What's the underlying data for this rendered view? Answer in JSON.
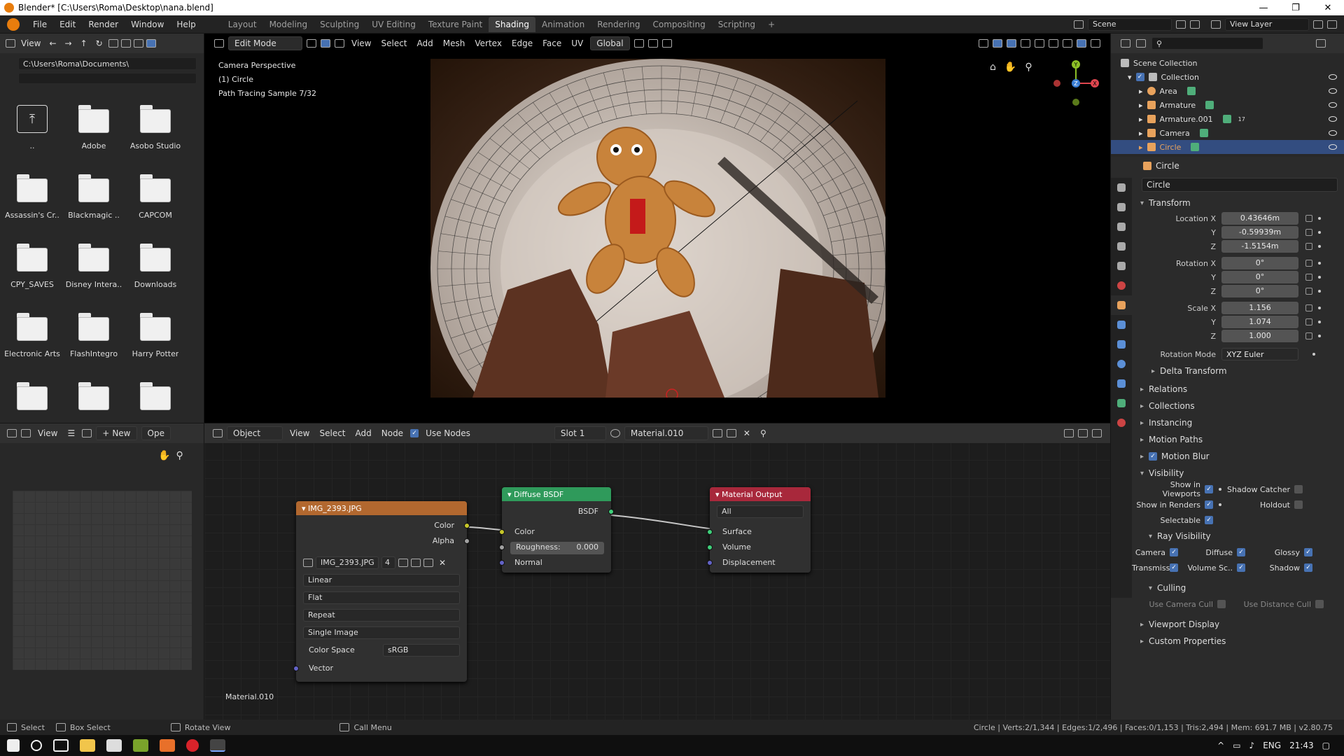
{
  "window": {
    "title": "Blender* [C:\\Users\\Roma\\Desktop\\nana.blend]",
    "min": "—",
    "max": "❐",
    "close": "✕"
  },
  "menu": {
    "items": [
      "File",
      "Edit",
      "Render",
      "Window",
      "Help"
    ]
  },
  "workspaces": {
    "tabs": [
      "Layout",
      "Modeling",
      "Sculpting",
      "UV Editing",
      "Texture Paint",
      "Shading",
      "Animation",
      "Rendering",
      "Compositing",
      "Scripting"
    ],
    "active": "Shading",
    "add": "+"
  },
  "scene": {
    "label": "Scene",
    "view_layer": "View Layer"
  },
  "filebrowser": {
    "view": "View",
    "path": "C:\\Users\\Roma\\Documents\\",
    "items": [
      {
        "label": "..",
        "type": "parent"
      },
      {
        "label": "Adobe",
        "type": "folder"
      },
      {
        "label": "Asobo Studio",
        "type": "folder"
      },
      {
        "label": "Assassin's Cr..",
        "type": "folder"
      },
      {
        "label": "Blackmagic ..",
        "type": "folder"
      },
      {
        "label": "CAPCOM",
        "type": "folder"
      },
      {
        "label": "CPY_SAVES",
        "type": "folder"
      },
      {
        "label": "Disney Intera..",
        "type": "folder"
      },
      {
        "label": "Downloads",
        "type": "folder"
      },
      {
        "label": "Electronic Arts",
        "type": "folder"
      },
      {
        "label": "FlashIntegro",
        "type": "folder"
      },
      {
        "label": "Harry Potter",
        "type": "folder"
      },
      {
        "label": "",
        "type": "folder"
      },
      {
        "label": "",
        "type": "folder"
      },
      {
        "label": "",
        "type": "folder"
      }
    ]
  },
  "viewport": {
    "mode": "Edit Mode",
    "menus": [
      "View",
      "Select",
      "Add",
      "Mesh",
      "Vertex",
      "Edge",
      "Face",
      "UV"
    ],
    "orientation": "Global",
    "info": [
      "Camera Perspective",
      "(1) Circle",
      "Path Tracing Sample 7/32"
    ],
    "gizmo": {
      "y": "Y",
      "z": "Z",
      "x": "X"
    }
  },
  "outliner": {
    "root": "Scene Collection",
    "collection": "Collection",
    "items": [
      {
        "label": "Area",
        "color": "#e8a25c"
      },
      {
        "label": "Armature",
        "color": "#e8a25c"
      },
      {
        "label": "Armature.001",
        "color": "#e8a25c"
      },
      {
        "label": "Camera",
        "color": "#e8a25c"
      },
      {
        "label": "Circle",
        "color": "#e8a25c",
        "selected": true
      }
    ],
    "armature_count": "17"
  },
  "properties": {
    "object_name": "Circle",
    "name_field": "Circle",
    "transform": {
      "title": "Transform",
      "location": {
        "label_x": "Location X",
        "x": "0.43646m",
        "y": "-0.59939m",
        "z": "-1.5154m"
      },
      "rotation": {
        "label_x": "Rotation X",
        "x": "0°",
        "y": "0°",
        "z": "0°"
      },
      "scale": {
        "label_x": "Scale X",
        "x": "1.156",
        "y": "1.074",
        "z": "1.000"
      },
      "axis_y": "Y",
      "axis_z": "Z",
      "rotation_mode_label": "Rotation Mode",
      "rotation_mode": "XYZ Euler",
      "delta": "Delta Transform"
    },
    "sections": [
      "Relations",
      "Collections",
      "Instancing",
      "Motion Paths",
      "Motion Blur"
    ],
    "visibility": {
      "title": "Visibility",
      "show_viewports": "Show in Viewports",
      "shadow_catcher": "Shadow Catcher",
      "show_renders": "Show in Renders",
      "holdout": "Holdout",
      "selectable": "Selectable",
      "ray_title": "Ray Visibility",
      "ray": [
        "Camera",
        "Diffuse",
        "Glossy",
        "Transmissi..",
        "Volume Sc..",
        "Shadow"
      ],
      "culling_title": "Culling",
      "camera_cull": "Use Camera Cull",
      "distance_cull": "Use Distance Cull"
    },
    "tail": [
      "Viewport Display",
      "Custom Properties"
    ]
  },
  "imgeditor": {
    "view": "View",
    "new": "New",
    "open": "Ope"
  },
  "nodeeditor": {
    "type": "Object",
    "menus": [
      "View",
      "Select",
      "Add",
      "Node"
    ],
    "use_nodes": "Use Nodes",
    "slot": "Slot 1",
    "material": "Material.010",
    "footer": "Material.010",
    "image_node": {
      "title": "IMG_2393.JPG",
      "out_color": "Color",
      "out_alpha": "Alpha",
      "image": "IMG_2393.JPG",
      "users": "4",
      "interp": "Linear",
      "proj": "Flat",
      "ext": "Repeat",
      "source": "Single Image",
      "cs_label": "Color Space",
      "cs": "sRGB",
      "in_vector": "Vector"
    },
    "bsdf_node": {
      "title": "Diffuse BSDF",
      "out": "BSDF",
      "in_color": "Color",
      "rough_label": "Roughness:",
      "rough": "0.000",
      "in_normal": "Normal"
    },
    "output_node": {
      "title": "Material Output",
      "target": "All",
      "surface": "Surface",
      "volume": "Volume",
      "displacement": "Displacement"
    }
  },
  "status": {
    "select": "Select",
    "box": "Box Select",
    "rotate": "Rotate View",
    "call": "Call Menu",
    "stats": "Circle | Verts:2/1,344 | Edges:1/2,496 | Faces:0/1,153 | Tris:2,494 | Mem: 691.7 MB | v2.80.75"
  },
  "taskbar": {
    "lang": "ENG",
    "time": "21:43"
  }
}
